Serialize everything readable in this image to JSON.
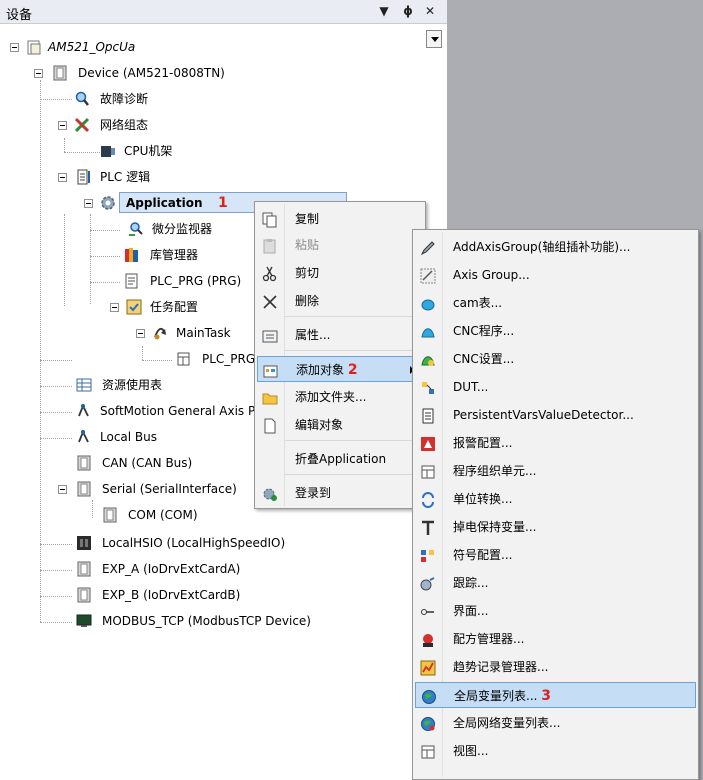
{
  "pane": {
    "title": "设备",
    "dropdown_glyph": "▼",
    "pin_glyph": "ᵖ",
    "close_glyph": "✕"
  },
  "tree": {
    "project": "AM521_OpcUa",
    "device": "Device (AM521-0808TN)",
    "fault_diagnosis": "故障诊断",
    "network_config": "网络组态",
    "cpu_rack": "CPU机架",
    "plc_logic": "PLC 逻辑",
    "application": "Application",
    "application_badge": "1",
    "micro_monitor": "微分监视器",
    "library_manager": "库管理器",
    "plc_prg": "PLC_PRG (PRG)",
    "task_config": "任务配置",
    "main_task": "MainTask",
    "plc_prg_call": "PLC_PRG",
    "resource_usage": "资源使用表",
    "softmotion_pool": "SoftMotion General Axis P",
    "local_bus": "Local Bus",
    "can_bus": "CAN (CAN Bus)",
    "serial": "Serial (SerialInterface)",
    "com": "COM (COM)",
    "local_hsio": "LocalHSIO (LocalHighSpeedIO)",
    "exp_a": "EXP_A (IoDrvExtCardA)",
    "exp_b": "EXP_B (IoDrvExtCardB)",
    "modbus_tcp": "MODBUS_TCP (ModbusTCP Device)"
  },
  "context_menu": {
    "copy": "复制",
    "paste": "粘贴",
    "cut": "剪切",
    "delete": "删除",
    "properties": "属性...",
    "add_object": "添加对象",
    "add_object_badge": "2",
    "add_folder": "添加文件夹...",
    "edit_object": "编辑对象",
    "collapse": "折叠Application",
    "login": "登录到"
  },
  "submenu": {
    "items": [
      "AddAxisGroup(轴组插补功能)...",
      "Axis Group...",
      "cam表...",
      "CNC程序...",
      "CNC设置...",
      "DUT...",
      "PersistentVarsValueDetector...",
      "报警配置...",
      "程序组织单元...",
      "单位转换...",
      "掉电保持变量...",
      "符号配置...",
      "跟踪...",
      "界面...",
      "配方管理器...",
      "趋势记录管理器...",
      "全局变量列表...",
      "全局网络变量列表...",
      "视图..."
    ],
    "highlight_badge": "3"
  },
  "colors": {
    "selection": "#d6e6f7",
    "menu_highlight": "#c5def5",
    "badge": "#e0211b",
    "background": "#abadb3"
  }
}
